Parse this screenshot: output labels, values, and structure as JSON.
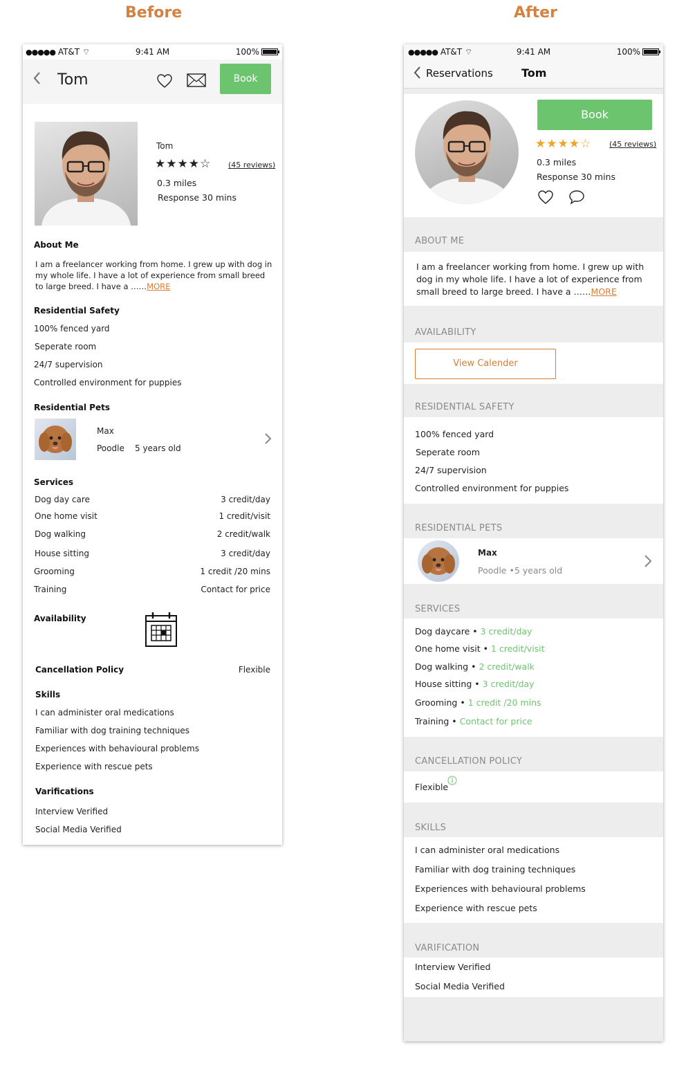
{
  "headings": {
    "before": "Before",
    "after": "After"
  },
  "status_bar": {
    "carrier": "AT&T",
    "time": "9:41 AM",
    "battery": "100%"
  },
  "sitter": {
    "name": "Tom",
    "rating_stars": 4,
    "rating_max": 5,
    "reviews": "(45 reviews)",
    "distance": "0.3 miles",
    "response": "Response 30 mins"
  },
  "before": {
    "book_label": "Book",
    "about_title": "About Me",
    "about_text": "I am a freelancer working from home. I grew up with dog in my whole life. I have a lot of experience from small breed to large breed. I have a ……",
    "more": "MORE",
    "safety_title": "Residential Safety",
    "pets_title": "Residential Pets",
    "services_title": "Services",
    "availability_title": "Availability",
    "cancellation_title": "Cancellation Policy",
    "cancellation_value": "Flexible",
    "skills_title": "Skills",
    "verifications_title": "Varifications"
  },
  "after": {
    "back_label": "Reservations",
    "book_label": "Book",
    "about_title": "ABOUT ME",
    "about_text": "I am a freelancer working from home. I grew up with dog in my whole life. I have a lot of experience from small breed to large breed. I have a ……",
    "more": "MORE",
    "availability_title": "AVAILABILITY",
    "view_calendar": "View Calender",
    "safety_title": "RESIDENTIAL SAFETY",
    "pets_title": "RESIDENTIAL PETS",
    "services_title": "SERVICES",
    "cancellation_title": "CANCELLATION POLICY",
    "cancellation_value": "Flexible",
    "skills_title": "SKILLS",
    "verifications_title": "VARIFICATION"
  },
  "safety": [
    "100% fenced yard",
    "Seperate room",
    "24/7 supervision",
    "Controlled environment for puppies"
  ],
  "pet": {
    "name": "Max",
    "breed": "Poodle",
    "age": "5 years old",
    "breed_age_after": "Poodle •5 years old"
  },
  "services_before": [
    {
      "name": "Dog day care",
      "price": "3 credit/day"
    },
    {
      "name": "One home visit",
      "price": "1 credit/visit"
    },
    {
      "name": "Dog walking",
      "price": "2 credit/walk"
    },
    {
      "name": "House sitting",
      "price": "3 credit/day"
    },
    {
      "name": "Grooming",
      "price": "1 credit /20 mins"
    },
    {
      "name": "Training",
      "price": "Contact for price"
    }
  ],
  "services_after": [
    {
      "name": "Dog daycare",
      "price": "3 credit/day"
    },
    {
      "name": "One home visit",
      "price": "1 credit/visit"
    },
    {
      "name": "Dog walking",
      "price": "2 credit/walk"
    },
    {
      "name": "House sitting",
      "price": "3 credit/day"
    },
    {
      "name": "Grooming",
      "price": "1 credit /20 mins"
    },
    {
      "name": "Training",
      "price": "Contact for price"
    }
  ],
  "skills": [
    "I can administer oral medications",
    "Familiar with dog training techniques",
    "Experiences with behavioural problems",
    "Experience with rescue pets"
  ],
  "verifications": [
    "Interview Verified",
    "Social Media Verified"
  ],
  "colors": {
    "accent_green": "#6dc46e",
    "accent_orange": "#e07b2c",
    "star_gold": "#f0a424",
    "heading_orange": "#d4823f"
  }
}
